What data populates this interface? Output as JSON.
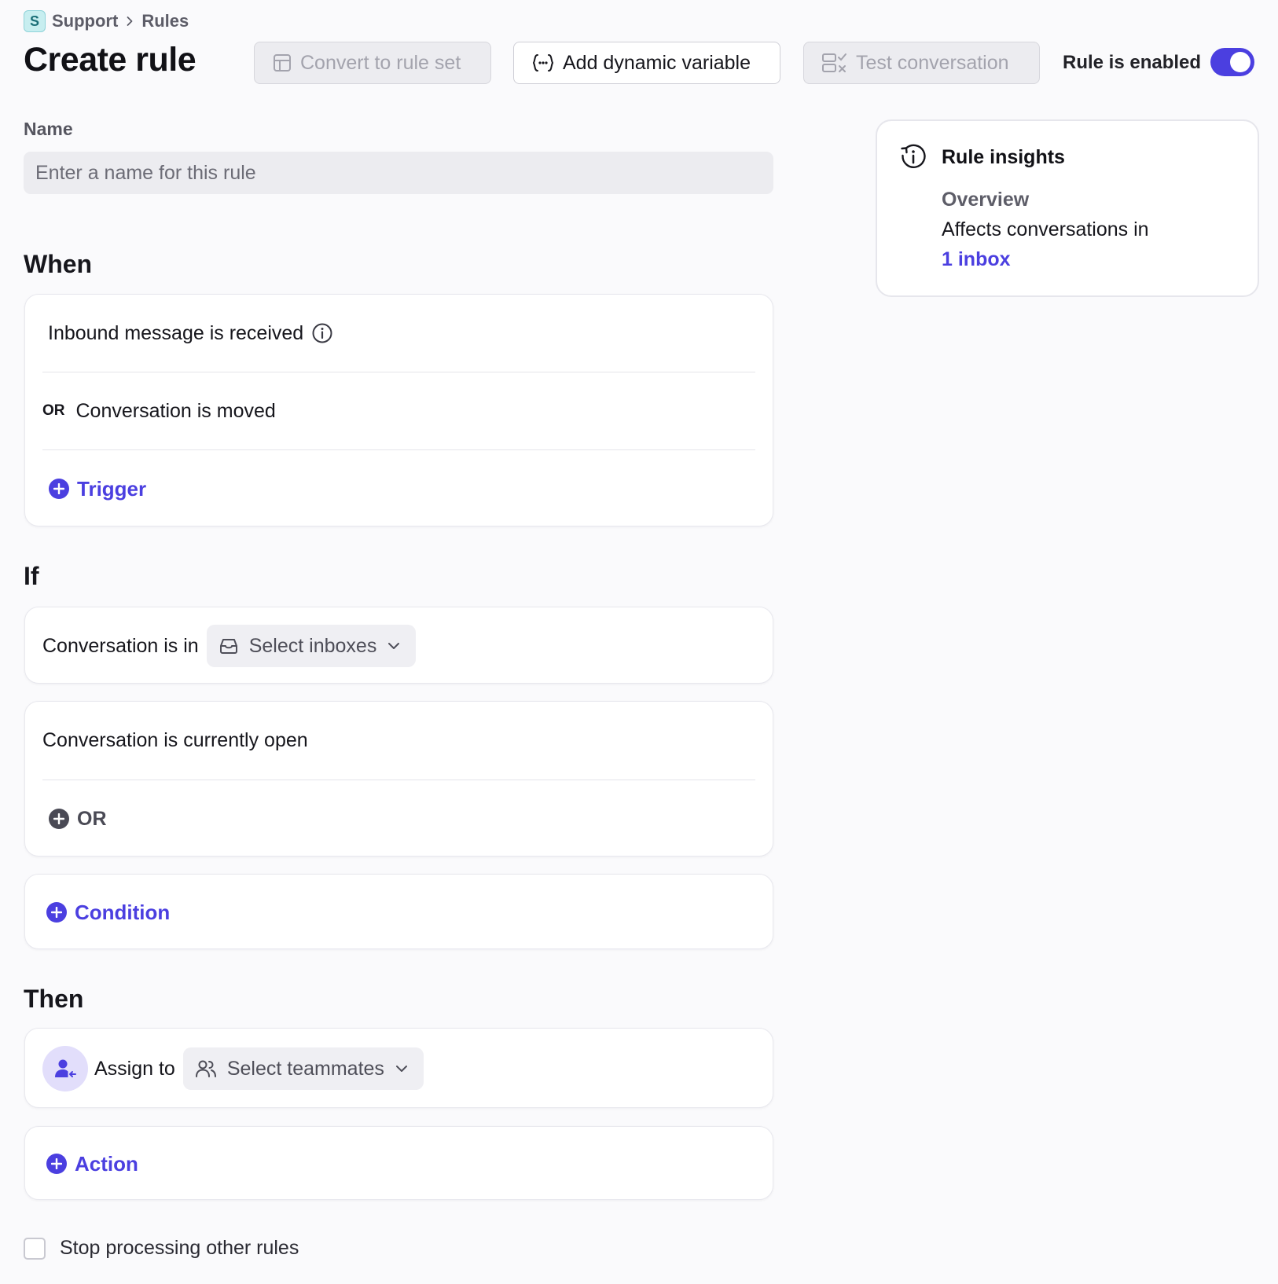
{
  "breadcrumb": {
    "workspace_badge": "S",
    "workspace": "Support",
    "page": "Rules"
  },
  "header": {
    "title": "Create rule",
    "convert_label": "Convert to rule set",
    "dynamic_label": "Add dynamic variable",
    "test_label": "Test conversation",
    "enabled_label": "Rule is enabled",
    "enabled": true
  },
  "name_field": {
    "label": "Name",
    "placeholder": "Enter a name for this rule",
    "value": ""
  },
  "when": {
    "title": "When",
    "triggers": [
      {
        "prefix": "",
        "label": "Inbound message is received"
      },
      {
        "prefix": "OR",
        "label": "Conversation is moved"
      }
    ],
    "add_label": "Trigger"
  },
  "if": {
    "title": "If",
    "inbox_condition": {
      "label": "Conversation is in",
      "select_placeholder": "Select inboxes"
    },
    "status_condition": {
      "label": "Conversation is currently open",
      "or_label": "OR"
    },
    "add_label": "Condition"
  },
  "then": {
    "title": "Then",
    "assign": {
      "label": "Assign to",
      "select_placeholder": "Select teammates"
    },
    "add_label": "Action"
  },
  "stop_processing": {
    "label": "Stop processing other rules",
    "checked": false
  },
  "insights": {
    "title": "Rule insights",
    "subtitle": "Overview",
    "text": "Affects conversations in",
    "link": "1 inbox"
  },
  "colors": {
    "accent": "#4b3fe0",
    "background": "#fafafc",
    "card": "#ffffff"
  }
}
